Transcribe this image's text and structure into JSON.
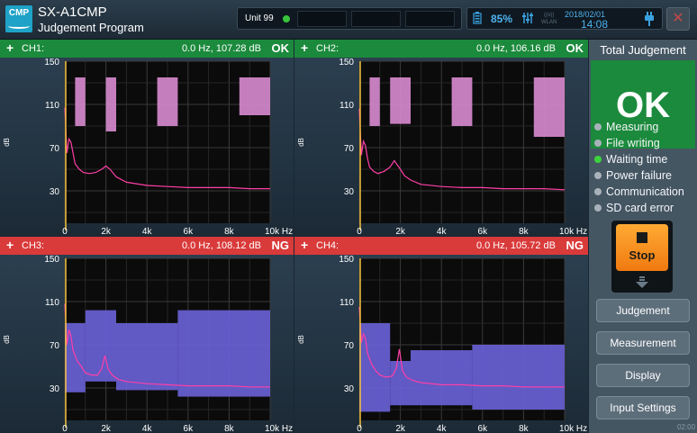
{
  "header": {
    "logo_text": "CMP",
    "title": "SX-A1CMP",
    "subtitle": "Judgement Program",
    "unit_label": "Unit 99",
    "battery": "85%",
    "wlan": "((o))\nWLAN",
    "date": "2018/02/01",
    "time": "14:08",
    "close_symbol": "✕"
  },
  "channels": [
    {
      "plus": "+",
      "name": "CH1:",
      "readout": "0.0 Hz, 107.28 dB",
      "judgement": "OK",
      "status": "ok"
    },
    {
      "plus": "+",
      "name": "CH2:",
      "readout": "0.0 Hz, 106.16 dB",
      "judgement": "OK",
      "status": "ok"
    },
    {
      "plus": "+",
      "name": "CH3:",
      "readout": "0.0 Hz, 108.12 dB",
      "judgement": "NG",
      "status": "ng"
    },
    {
      "plus": "+",
      "name": "CH4:",
      "readout": "0.0 Hz, 105.72 dB",
      "judgement": "NG",
      "status": "ng"
    }
  ],
  "chart_data": [
    {
      "type": "line",
      "channel": "CH1",
      "xlim": [
        0,
        10000
      ],
      "ylim": [
        0,
        150
      ],
      "xticks": [
        "0",
        "2k",
        "4k",
        "6k",
        "8k",
        "10k Hz"
      ],
      "yticks": [
        "150",
        "110",
        "70",
        "30"
      ],
      "ytick_values": [
        150,
        110,
        70,
        30
      ],
      "ylabel": "dB",
      "grid": true,
      "mask_color": "#d98bd0",
      "masks": [
        [
          500,
          1000,
          90,
          135
        ],
        [
          2000,
          2500,
          85,
          135
        ],
        [
          4500,
          5500,
          90,
          135
        ],
        [
          8500,
          10000,
          100,
          135
        ]
      ],
      "x": [
        0,
        100,
        200,
        300,
        400,
        500,
        700,
        900,
        1200,
        1500,
        1800,
        2000,
        2200,
        2500,
        3000,
        4000,
        5000,
        6000,
        7000,
        8000,
        9000,
        10000
      ],
      "y": [
        107,
        65,
        78,
        75,
        65,
        55,
        50,
        47,
        46,
        47,
        50,
        53,
        50,
        43,
        38,
        35,
        34,
        33,
        33,
        33,
        32,
        32
      ]
    },
    {
      "type": "line",
      "channel": "CH2",
      "xlim": [
        0,
        10000
      ],
      "ylim": [
        0,
        150
      ],
      "xticks": [
        "0",
        "2k",
        "4k",
        "6k",
        "8k",
        "10k Hz"
      ],
      "yticks": [
        "150",
        "110",
        "70",
        "30"
      ],
      "ytick_values": [
        150,
        110,
        70,
        30
      ],
      "ylabel": "dB",
      "grid": true,
      "mask_color": "#d98bd0",
      "masks": [
        [
          500,
          1000,
          90,
          135
        ],
        [
          1500,
          2500,
          92,
          135
        ],
        [
          4500,
          5500,
          90,
          135
        ],
        [
          8500,
          10000,
          80,
          135
        ]
      ],
      "x": [
        0,
        100,
        200,
        300,
        400,
        500,
        700,
        900,
        1200,
        1500,
        1700,
        2000,
        2200,
        2500,
        3000,
        4000,
        5000,
        6000,
        7000,
        8000,
        9000,
        10000
      ],
      "y": [
        106,
        63,
        76,
        72,
        60,
        52,
        48,
        46,
        48,
        52,
        58,
        50,
        44,
        40,
        36,
        34,
        33,
        33,
        32,
        32,
        32,
        31
      ]
    },
    {
      "type": "line",
      "channel": "CH3",
      "xlim": [
        0,
        10000
      ],
      "ylim": [
        0,
        150
      ],
      "xticks": [
        "0",
        "2k",
        "4k",
        "6k",
        "8k",
        "10k Hz"
      ],
      "yticks": [
        "150",
        "110",
        "70",
        "30"
      ],
      "ytick_values": [
        150,
        110,
        70,
        30
      ],
      "ylabel": "dB",
      "grid": true,
      "mask_color": "#6a62d8",
      "masks": [
        [
          0,
          1000,
          26,
          90
        ],
        [
          1000,
          2500,
          36,
          102
        ],
        [
          2500,
          5500,
          28,
          90
        ],
        [
          5500,
          10000,
          22,
          102
        ]
      ],
      "x": [
        0,
        100,
        200,
        300,
        400,
        600,
        800,
        1000,
        1300,
        1600,
        1800,
        1950,
        2100,
        2300,
        2600,
        3000,
        4000,
        5000,
        6000,
        7000,
        8000,
        9000,
        10000
      ],
      "y": [
        108,
        70,
        84,
        78,
        65,
        55,
        50,
        44,
        42,
        42,
        48,
        60,
        48,
        42,
        38,
        36,
        34,
        33,
        32,
        32,
        32,
        31,
        31
      ]
    },
    {
      "type": "line",
      "channel": "CH4",
      "xlim": [
        0,
        10000
      ],
      "ylim": [
        0,
        150
      ],
      "xticks": [
        "0",
        "2k",
        "4k",
        "6k",
        "8k",
        "10k Hz"
      ],
      "yticks": [
        "150",
        "110",
        "70",
        "30"
      ],
      "ytick_values": [
        150,
        110,
        70,
        30
      ],
      "ylabel": "dB",
      "grid": true,
      "mask_color": "#6a62d8",
      "masks": [
        [
          0,
          1500,
          8,
          90
        ],
        [
          1500,
          2500,
          14,
          55
        ],
        [
          2500,
          5500,
          14,
          65
        ],
        [
          5500,
          10000,
          10,
          70
        ]
      ],
      "x": [
        0,
        100,
        200,
        300,
        400,
        600,
        800,
        1000,
        1300,
        1600,
        1800,
        1950,
        2100,
        2300,
        2600,
        3000,
        4000,
        5000,
        6000,
        7000,
        8000,
        9000,
        10000
      ],
      "y": [
        105,
        72,
        80,
        76,
        62,
        52,
        46,
        42,
        40,
        41,
        48,
        66,
        46,
        40,
        37,
        35,
        33,
        33,
        32,
        32,
        31,
        31,
        31
      ]
    }
  ],
  "side": {
    "title": "Total Judgement",
    "value": "OK",
    "statuses": [
      {
        "label": "Measuring",
        "on": false
      },
      {
        "label": "File writing",
        "on": false
      },
      {
        "label": "Waiting time",
        "on": true
      },
      {
        "label": "Power failure",
        "on": false
      },
      {
        "label": "Communication",
        "on": false
      },
      {
        "label": "SD card error",
        "on": false
      }
    ],
    "stop_label": "Stop",
    "buttons": [
      "Judgement",
      "Measurement",
      "Display",
      "Input Settings"
    ],
    "footer_time": "02:00"
  },
  "colors": {
    "ok": "#1b8a3c",
    "ng": "#d93a3a",
    "trace": "#ff3fa8",
    "cursor": "#f5c23a",
    "plot_bg": "#0b0b0b"
  }
}
